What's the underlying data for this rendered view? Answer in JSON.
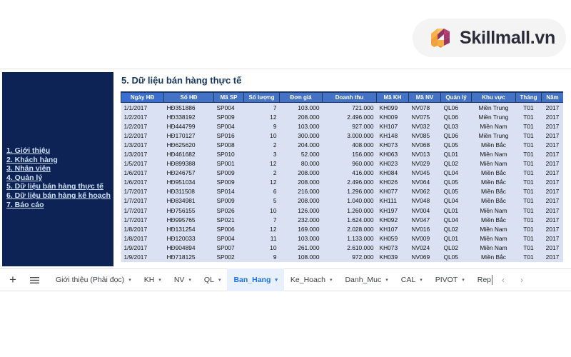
{
  "brand": {
    "name": "Skillmall.vn",
    "logo_icon": "skillmall-s-logo",
    "logo_colors": {
      "orange": "#f5a23c",
      "magenta": "#a93a6e"
    }
  },
  "sheet": {
    "title": "5. Dữ liệu bán hàng thực tế",
    "nav_panel": {
      "background": "#0d2255",
      "links": [
        {
          "label": "1. Giới thiệu"
        },
        {
          "label": "2. Khách hàng"
        },
        {
          "label": "3. Nhân viên"
        },
        {
          "label": "4. Quản lý"
        },
        {
          "label": "5. Dữ liệu bán hàng thực tế"
        },
        {
          "label": "6. Dữ liệu bán hàng kế hoạch"
        },
        {
          "label": "7. Báo cáo"
        }
      ]
    }
  },
  "table": {
    "header_color": "#4472c4",
    "row_color": "#d9e1f2",
    "columns": [
      {
        "label": "Ngày HĐ",
        "align": "c-left"
      },
      {
        "label": "Số HĐ",
        "align": "c-left"
      },
      {
        "label": "Mã SP",
        "align": "c-left"
      },
      {
        "label": "Số lượng",
        "align": "c-right"
      },
      {
        "label": "Đơn giá",
        "align": "c-right"
      },
      {
        "label": "Doanh thu",
        "align": "c-right"
      },
      {
        "label": "Mã KH",
        "align": "c-left"
      },
      {
        "label": "Mã NV",
        "align": "c-left"
      },
      {
        "label": "Quản lý",
        "align": "c-left"
      },
      {
        "label": "Khu vực",
        "align": "c-center"
      },
      {
        "label": "Tháng",
        "align": "c-center"
      },
      {
        "label": "Năm",
        "align": "c-center"
      }
    ],
    "rows": [
      [
        "1/1/2017",
        "HĐ351886",
        "SP004",
        "7",
        "103.000",
        "721.000",
        "KH099",
        "NV078",
        "QL06",
        "Miền Trung",
        "T01",
        "2017"
      ],
      [
        "1/2/2017",
        "HĐ338192",
        "SP009",
        "12",
        "208.000",
        "2.496.000",
        "KH009",
        "NV075",
        "QL06",
        "Miền Trung",
        "T01",
        "2017"
      ],
      [
        "1/2/2017",
        "HĐ444799",
        "SP004",
        "9",
        "103.000",
        "927.000",
        "KH107",
        "NV032",
        "QL03",
        "Miền Nam",
        "T01",
        "2017"
      ],
      [
        "1/2/2017",
        "HĐ170127",
        "SP016",
        "10",
        "300.000",
        "3.000.000",
        "KH148",
        "NV085",
        "QL06",
        "Miền Trung",
        "T01",
        "2017"
      ],
      [
        "1/3/2017",
        "HĐ625620",
        "SP008",
        "2",
        "204.000",
        "408.000",
        "KH073",
        "NV068",
        "QL05",
        "Miền Bắc",
        "T01",
        "2017"
      ],
      [
        "1/3/2017",
        "HĐ461682",
        "SP010",
        "3",
        "52.000",
        "156.000",
        "KH063",
        "NV013",
        "QL01",
        "Miền Nam",
        "T01",
        "2017"
      ],
      [
        "1/5/2017",
        "HĐ899388",
        "SP001",
        "12",
        "80.000",
        "960.000",
        "KH023",
        "NV029",
        "QL02",
        "Miền Nam",
        "T01",
        "2017"
      ],
      [
        "1/6/2017",
        "HĐ246757",
        "SP009",
        "2",
        "208.000",
        "416.000",
        "KH084",
        "NV045",
        "QL04",
        "Miền Bắc",
        "T01",
        "2017"
      ],
      [
        "1/6/2017",
        "HĐ951034",
        "SP009",
        "12",
        "208.000",
        "2.496.000",
        "KH026",
        "NV064",
        "QL05",
        "Miền Bắc",
        "T01",
        "2017"
      ],
      [
        "1/7/2017",
        "HĐ311508",
        "SP014",
        "6",
        "216.000",
        "1.296.000",
        "KH077",
        "NV062",
        "QL05",
        "Miền Bắc",
        "T01",
        "2017"
      ],
      [
        "1/7/2017",
        "HĐ834981",
        "SP009",
        "5",
        "208.000",
        "1.040.000",
        "KH111",
        "NV048",
        "QL04",
        "Miền Bắc",
        "T01",
        "2017"
      ],
      [
        "1/7/2017",
        "HĐ756155",
        "SP026",
        "10",
        "126.000",
        "1.260.000",
        "KH197",
        "NV004",
        "QL01",
        "Miền Nam",
        "T01",
        "2017"
      ],
      [
        "1/7/2017",
        "HĐ995765",
        "SP021",
        "7",
        "232.000",
        "1.624.000",
        "KH092",
        "NV047",
        "QL04",
        "Miền Bắc",
        "T01",
        "2017"
      ],
      [
        "1/8/2017",
        "HĐ131254",
        "SP006",
        "12",
        "169.000",
        "2.028.000",
        "KH107",
        "NV016",
        "QL02",
        "Miền Nam",
        "T01",
        "2017"
      ],
      [
        "1/8/2017",
        "HĐ120033",
        "SP004",
        "11",
        "103.000",
        "1.133.000",
        "KH059",
        "NV009",
        "QL01",
        "Miền Nam",
        "T01",
        "2017"
      ],
      [
        "1/9/2017",
        "HĐ904894",
        "SP007",
        "10",
        "261.000",
        "2.610.000",
        "KH073",
        "NV024",
        "QL02",
        "Miền Nam",
        "T01",
        "2017"
      ],
      [
        "1/9/2017",
        "HĐ718125",
        "SP002",
        "9",
        "108.000",
        "972.000",
        "KH039",
        "NV069",
        "QL05",
        "Miền Bắc",
        "T01",
        "2017"
      ]
    ]
  },
  "tabbar": {
    "add_icon": "plus-icon",
    "all_sheets_icon": "hamburger-menu-icon",
    "prev_icon": "chevron-left-icon",
    "next_icon": "chevron-right-icon",
    "caret_icon": "▾",
    "tabs": [
      {
        "label": "Giới thiệu (Phải đọc)",
        "active": false
      },
      {
        "label": "KH",
        "active": false
      },
      {
        "label": "NV",
        "active": false
      },
      {
        "label": "QL",
        "active": false
      },
      {
        "label": "Ban_Hang",
        "active": true
      },
      {
        "label": "Ke_Hoach",
        "active": false
      },
      {
        "label": "Danh_Muc",
        "active": false
      },
      {
        "label": "CAL",
        "active": false
      },
      {
        "label": "PIVOT",
        "active": false
      },
      {
        "label": "Rep",
        "active": false,
        "truncated": true
      }
    ]
  }
}
